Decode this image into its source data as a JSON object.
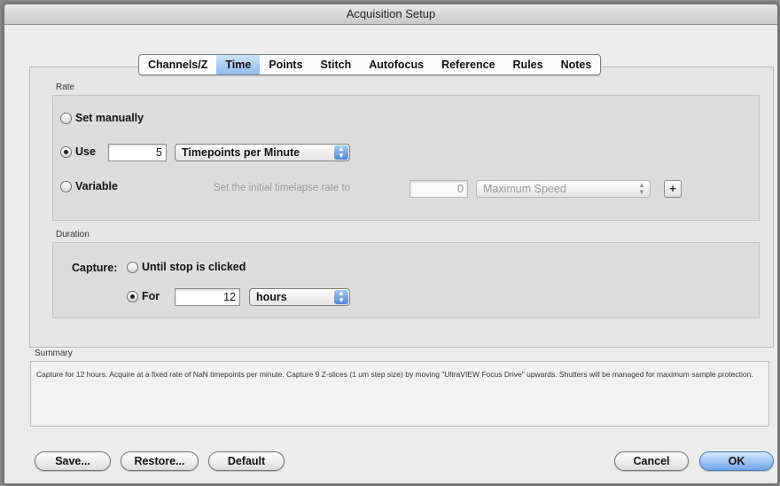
{
  "window": {
    "title": "Acquisition Setup"
  },
  "tabs": [
    {
      "label": "Channels/Z",
      "selected": false
    },
    {
      "label": "Time",
      "selected": true
    },
    {
      "label": "Points",
      "selected": false
    },
    {
      "label": "Stitch",
      "selected": false
    },
    {
      "label": "Autofocus",
      "selected": false
    },
    {
      "label": "Reference",
      "selected": false
    },
    {
      "label": "Rules",
      "selected": false
    },
    {
      "label": "Notes",
      "selected": false
    }
  ],
  "rate": {
    "group_label": "Rate",
    "set_manually_label": "Set manually",
    "use_label": "Use",
    "use_value": "5",
    "use_unit": "Timepoints per Minute",
    "variable_label": "Variable",
    "variable_prompt": "Set the initial timelapse rate to",
    "variable_value": "0",
    "variable_unit": "Maximum Speed",
    "add_label": "+",
    "selected": "use"
  },
  "duration": {
    "group_label": "Duration",
    "capture_label": "Capture:",
    "until_stop_label": "Until stop is clicked",
    "for_label": "For",
    "for_value": "12",
    "for_unit": "hours",
    "selected": "for"
  },
  "summary": {
    "label": "Summary",
    "text": "Capture for 12 hours. Acquire at a fixed rate of NaN timepoints per minute. Capture 9 Z-slices (1 um step size) by moving \"UltraVIEW Focus Drive\" upwards. Shutters will be managed for maximum sample protection."
  },
  "buttons": {
    "save": "Save...",
    "restore": "Restore...",
    "default": "Default",
    "cancel": "Cancel",
    "ok": "OK"
  },
  "icons": {
    "popup_arrows": "up-down-arrows-icon"
  }
}
